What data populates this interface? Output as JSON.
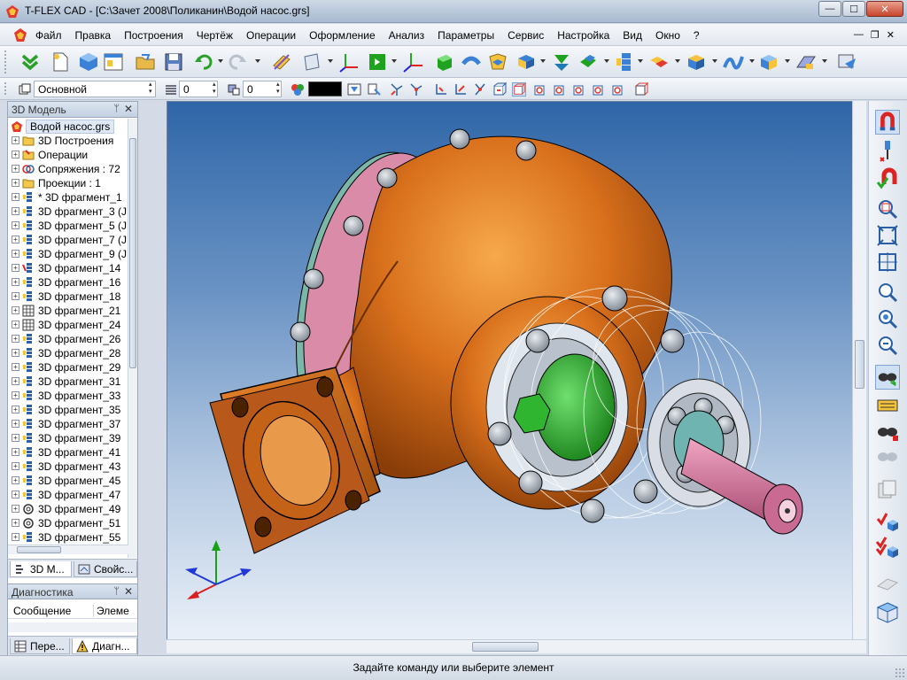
{
  "window": {
    "title": "T-FLEX CAD - [C:\\Зачет 2008\\Поликанин\\Водой насос.grs]",
    "minimize": "—",
    "maximize": "☐",
    "close": "✕"
  },
  "menu": {
    "items": [
      "Файл",
      "Правка",
      "Построения",
      "Чертёж",
      "Операции",
      "Оформление",
      "Анализ",
      "Параметры",
      "Сервис",
      "Настройка",
      "Вид",
      "Окно",
      "?"
    ],
    "mdi_min": "—",
    "mdi_restore": "❐",
    "mdi_close": "✕"
  },
  "toolbar2": {
    "layer": "Основной",
    "level1": "0",
    "level2": "0"
  },
  "left_panel": {
    "title": "3D Модель",
    "pin": "ᛘ",
    "close": "✕",
    "root": "Водой насос.grs",
    "items": [
      {
        "label": "3D Построения",
        "icon": "folder"
      },
      {
        "label": "Операции",
        "icon": "folder-ops"
      },
      {
        "label": "Сопряжения : 72",
        "icon": "mates"
      },
      {
        "label": "Проекции : 1",
        "icon": "folder"
      },
      {
        "label": "* 3D фрагмент_1",
        "icon": "fragment"
      },
      {
        "label": "3D фрагмент_3 (J",
        "icon": "fragment"
      },
      {
        "label": "3D фрагмент_5 (J",
        "icon": "fragment"
      },
      {
        "label": "3D фрагмент_7 (J",
        "icon": "fragment"
      },
      {
        "label": "3D фрагмент_9 (J",
        "icon": "fragment"
      },
      {
        "label": "3D фрагмент_14",
        "icon": "fragment-red"
      },
      {
        "label": "3D фрагмент_16",
        "icon": "fragment"
      },
      {
        "label": "3D фрагмент_18",
        "icon": "fragment"
      },
      {
        "label": "3D фрагмент_21",
        "icon": "fragment-grid"
      },
      {
        "label": "3D фрагмент_24",
        "icon": "fragment-grid"
      },
      {
        "label": "3D фрагмент_26",
        "icon": "fragment"
      },
      {
        "label": "3D фрагмент_28",
        "icon": "fragment"
      },
      {
        "label": "3D фрагмент_29",
        "icon": "fragment"
      },
      {
        "label": "3D фрагмент_31",
        "icon": "fragment"
      },
      {
        "label": "3D фрагмент_33",
        "icon": "fragment"
      },
      {
        "label": "3D фрагмент_35",
        "icon": "fragment"
      },
      {
        "label": "3D фрагмент_37",
        "icon": "fragment"
      },
      {
        "label": "3D фрагмент_39",
        "icon": "fragment"
      },
      {
        "label": "3D фрагмент_41",
        "icon": "fragment"
      },
      {
        "label": "3D фрагмент_43",
        "icon": "fragment"
      },
      {
        "label": "3D фрагмент_45",
        "icon": "fragment"
      },
      {
        "label": "3D фрагмент_47",
        "icon": "fragment"
      },
      {
        "label": "3D фрагмент_49",
        "icon": "fragment-ring"
      },
      {
        "label": "3D фрагмент_51",
        "icon": "fragment-ring"
      },
      {
        "label": "3D фрагмент_55",
        "icon": "fragment"
      }
    ],
    "tabs": [
      "3D M...",
      "Свойс..."
    ]
  },
  "diagnostics": {
    "title": "Диагностика",
    "pin": "ᛘ",
    "close": "✕",
    "col_message": "Сообщение",
    "col_element": "Элеме",
    "tabs": [
      "Пере...",
      "Диагн..."
    ]
  },
  "status": {
    "message": "Задайте команду или выберите элемент"
  },
  "colors": {
    "pump_body": "#d2691e",
    "flange_pink": "#d98ba8",
    "shaft_pink": "#c86b8f",
    "green_part": "#1fa31f",
    "viewport_top": "#2f66a8",
    "viewport_bottom": "#eaf0f8"
  }
}
